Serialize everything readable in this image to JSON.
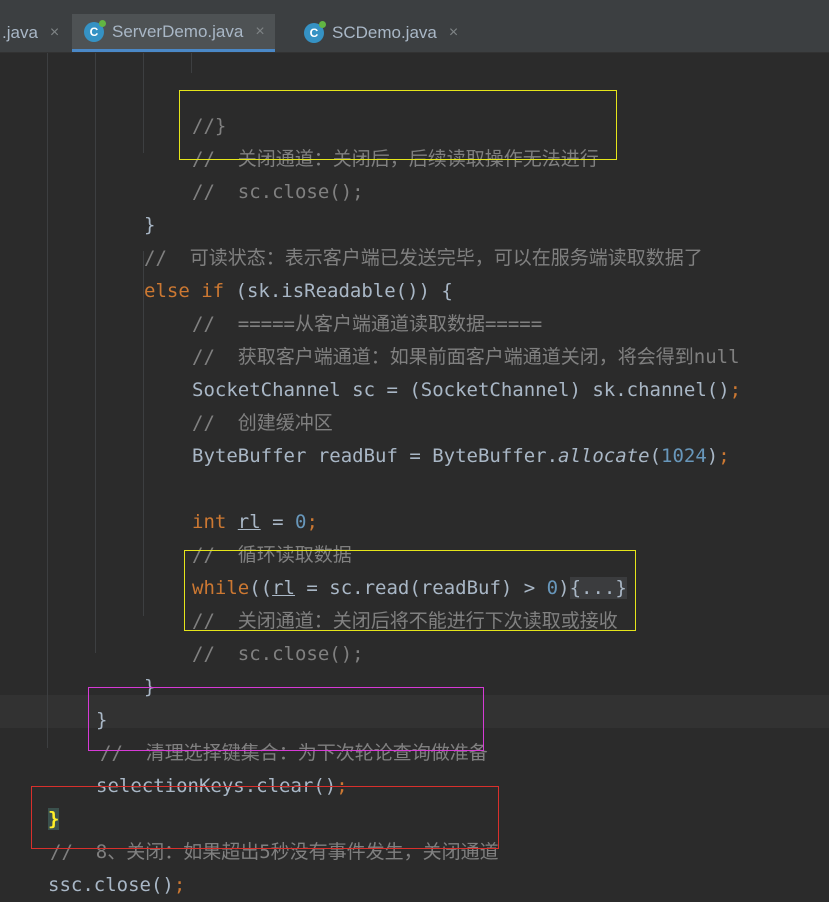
{
  "tabs": [
    {
      "label": ".java"
    },
    {
      "label": "ServerDemo.java",
      "icon": "C"
    },
    {
      "label": "SCDemo.java",
      "icon": "C"
    }
  ],
  "close_glyph": "×",
  "code": {
    "l1": "//}",
    "l2": "//  关闭通道：关闭后，后续读取操作无法进行",
    "l3": "//  sc.close();",
    "l4": "}",
    "l5": "//  可读状态：表示客户端已发送完毕，可以在服务端读取数据了",
    "l6_kw": "else if",
    "l6_rest": " (sk.isReadable()) {",
    "l7": "//  =====从客户端通道读取数据=====",
    "l8": "//  获取客户端通道：如果前面客户端通道关闭，将会得到null",
    "l9_a": "SocketChannel sc = (SocketChannel) sk.channel()",
    "l10": "//  创建缓冲区",
    "l11_a": "ByteBuffer readBuf = ByteBuffer.",
    "l11_m": "allocate",
    "l11_p1": "(",
    "l11_n": "1024",
    "l11_p2": ")",
    "l12_kw": "int",
    "l12_var": "rl",
    "l12_eq": " = ",
    "l12_n": "0",
    "l13": "//  循环读取数据",
    "l14_kw": "while",
    "l14_a": "((",
    "l14_var": "rl",
    "l14_b": " = sc.read(readBuf) > ",
    "l14_n": "0",
    "l14_c": ")",
    "l14_fold": "{...}",
    "l15": "//  关闭通道：关闭后将不能进行下次读取或接收",
    "l16": "//  sc.close();",
    "l17": "}",
    "l18": "}",
    "l19": "//  清理选择键集合：为下次轮论查询做准备",
    "l20": "selectionKeys.clear()",
    "l21": "}",
    "l22": "//  8、关闭：如果超出5秒没有事件发生，关闭通道",
    "l23": "ssc.close()",
    "semicolon": ";"
  },
  "colors": {
    "background": "#2b2b2b",
    "keyword": "#cc7832",
    "number": "#6897bb",
    "comment": "#808080",
    "box_yellow": "#e5e51a",
    "box_magenta": "#d63ad6",
    "box_red": "#d9302c"
  }
}
